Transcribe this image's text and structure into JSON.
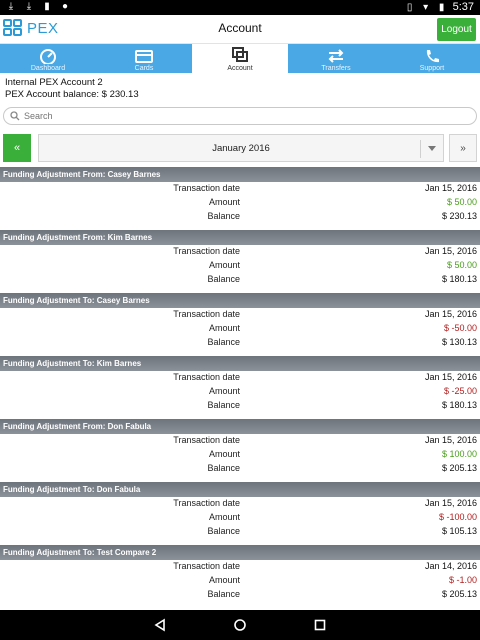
{
  "statusbar": {
    "time": "5:37"
  },
  "appbar": {
    "logo_text": "PEX",
    "title": "Account",
    "logout_label": "Logout"
  },
  "tabs": [
    {
      "label": "Dashboard",
      "icon": "dashboard-icon"
    },
    {
      "label": "Cards",
      "icon": "card-icon"
    },
    {
      "label": "Account",
      "icon": "account-icon"
    },
    {
      "label": "Transfers",
      "icon": "transfers-icon"
    },
    {
      "label": "Support",
      "icon": "phone-icon"
    }
  ],
  "account": {
    "name": "Internal PEX Account 2",
    "balance_line": "PEX Account balance: $ 230.13"
  },
  "search": {
    "placeholder": "Search"
  },
  "month": {
    "prev_label": "«",
    "current": "January 2016",
    "next_label": "»"
  },
  "labels": {
    "date": "Transaction date",
    "amount": "Amount",
    "balance": "Balance"
  },
  "transactions": [
    {
      "title": "Funding Adjustment From: Casey Barnes",
      "date": "Jan 15, 2016",
      "amount": "$ 50.00",
      "balance": "$ 230.13"
    },
    {
      "title": "Funding Adjustment From: Kim Barnes",
      "date": "Jan 15, 2016",
      "amount": "$ 50.00",
      "balance": "$ 180.13"
    },
    {
      "title": "Funding Adjustment To: Casey Barnes",
      "date": "Jan 15, 2016",
      "amount": "$ -50.00",
      "balance": "$ 130.13"
    },
    {
      "title": "Funding Adjustment To: Kim Barnes",
      "date": "Jan 15, 2016",
      "amount": "$ -25.00",
      "balance": "$ 180.13"
    },
    {
      "title": "Funding Adjustment From: Don Fabula",
      "date": "Jan 15, 2016",
      "amount": "$ 100.00",
      "balance": "$ 205.13"
    },
    {
      "title": "Funding Adjustment To: Don Fabula",
      "date": "Jan 15, 2016",
      "amount": "$ -100.00",
      "balance": "$ 105.13"
    },
    {
      "title": "Funding Adjustment To: Test Compare 2",
      "date": "Jan 14, 2016",
      "amount": "$ -1.00",
      "balance": "$ 205.13"
    }
  ],
  "colors": {
    "accent_blue": "#4aa8e4",
    "logout_green": "#3ab03a",
    "positive": "#4a9e1c",
    "negative": "#b21f1f"
  }
}
